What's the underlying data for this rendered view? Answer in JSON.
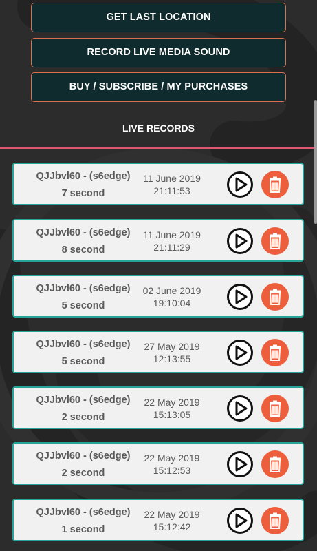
{
  "colors": {
    "background": "#2c2c2c",
    "button_fill": "#102b2d",
    "button_border": "#d9704f",
    "divider": "#e0586f",
    "card_border": "#26a49a",
    "card_fill": "#f1f1f1",
    "delete_fill": "#ec5e3c"
  },
  "buttons": {
    "get_last_location": "GET LAST LOCATION",
    "record_live_media_sound": "RECORD LIVE MEDIA SOUND",
    "buy_subscribe": "BUY / SUBSCRIBE / MY PURCHASES"
  },
  "section": {
    "title": "LIVE RECORDS"
  },
  "icons": {
    "play": "play-circle-icon",
    "delete": "trash-icon"
  },
  "records": [
    {
      "name": "QJJbvl60 - (s6edge)",
      "duration": "7 second",
      "date": "11 June 2019",
      "time": "21:11:53"
    },
    {
      "name": "QJJbvl60 - (s6edge)",
      "duration": "8 second",
      "date": "11 June 2019",
      "time": "21:11:29"
    },
    {
      "name": "QJJbvl60 - (s6edge)",
      "duration": "5 second",
      "date": "02 June 2019",
      "time": "19:10:04"
    },
    {
      "name": "QJJbvl60 - (s6edge)",
      "duration": "5 second",
      "date": "27 May 2019",
      "time": "12:13:55"
    },
    {
      "name": "QJJbvl60 - (s6edge)",
      "duration": "2 second",
      "date": "22 May 2019",
      "time": "15:13:05"
    },
    {
      "name": "QJJbvl60 - (s6edge)",
      "duration": "2 second",
      "date": "22 May 2019",
      "time": "15:12:53"
    },
    {
      "name": "QJJbvl60 - (s6edge)",
      "duration": "1 second",
      "date": "22 May 2019",
      "time": "15:12:42"
    }
  ]
}
